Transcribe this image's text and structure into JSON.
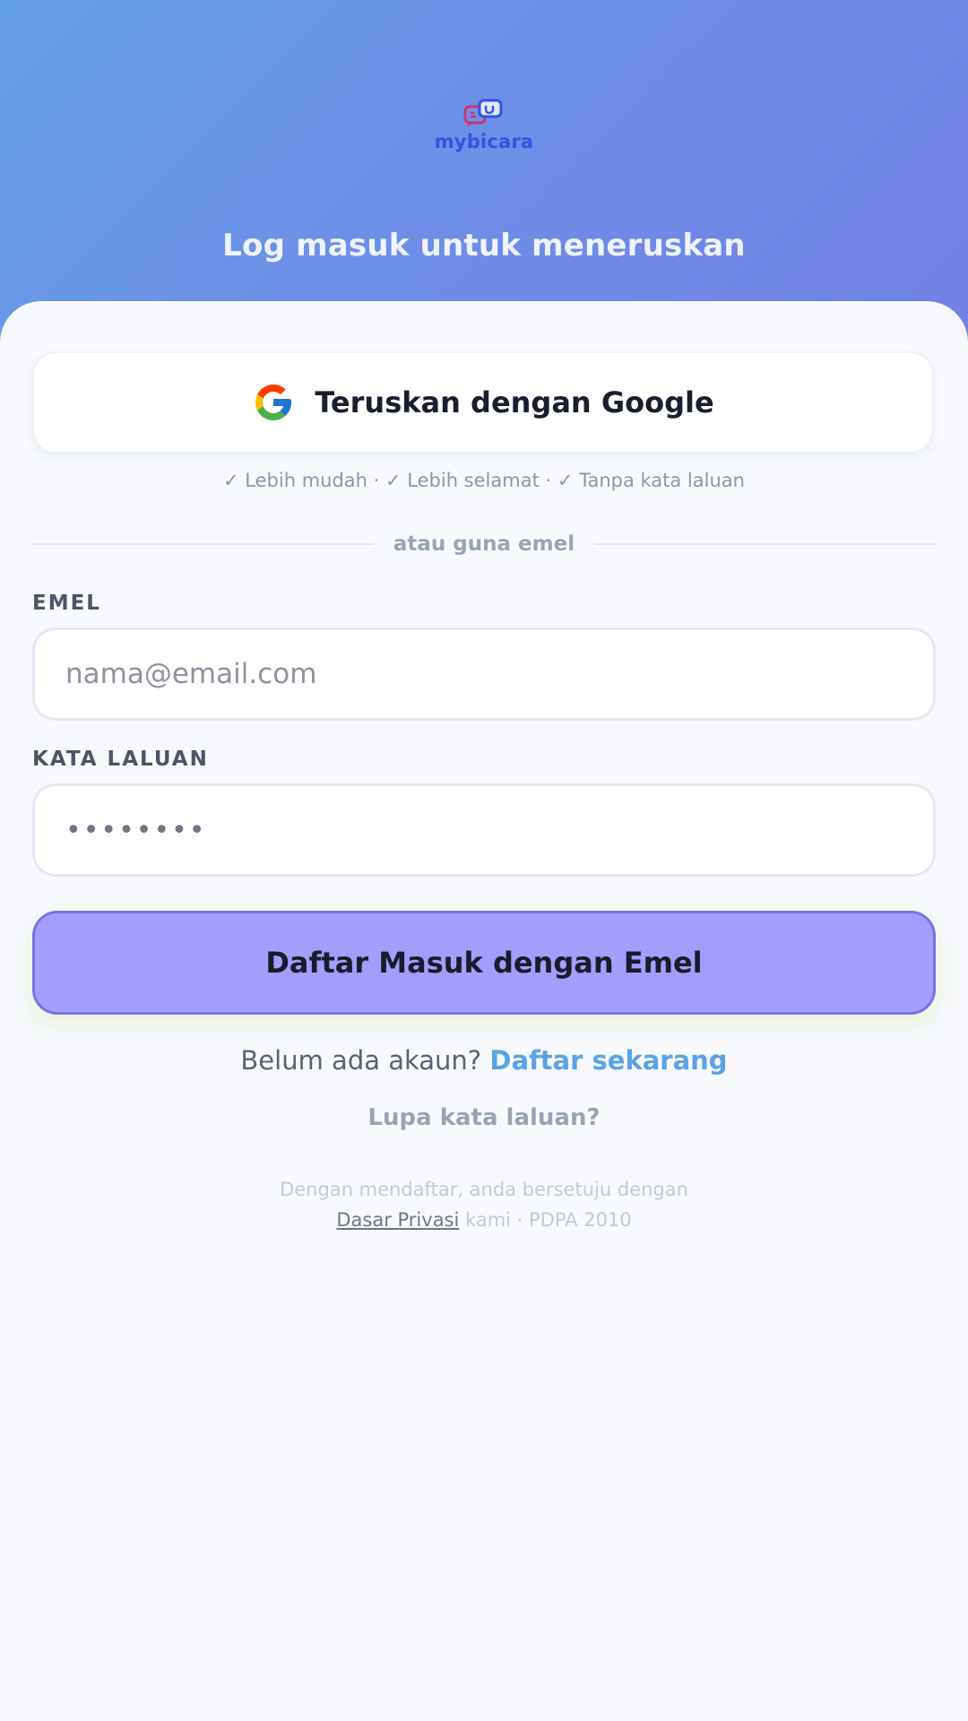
{
  "brand": {
    "name": "mybicara",
    "logo_icon": "chat-bubbles-icon",
    "colors": {
      "hero_gradient_start": "#62a0e6",
      "hero_gradient_end": "#7280e4",
      "primary_button": "#a39dfd",
      "link": "#5aa3e6"
    }
  },
  "header": {
    "title": "Log masuk untuk meneruskan"
  },
  "google": {
    "label": "Teruskan dengan Google",
    "icon": "google-g-icon",
    "perks": "✓ Lebih mudah · ✓ Lebih selamat · ✓ Tanpa kata laluan"
  },
  "divider": {
    "text": "atau guna emel"
  },
  "form": {
    "email_label": "EMEL",
    "email_placeholder": "nama@email.com",
    "email_value": "",
    "password_label": "KATA LALUAN",
    "password_value": "••••••••",
    "submit_label": "Daftar Masuk dengan Emel"
  },
  "footer": {
    "no_account_text": "Belum ada akaun?",
    "signup_link": "Daftar sekarang",
    "forgot_link": "Lupa kata laluan?",
    "legal_line1": "Dengan mendaftar, anda bersetuju dengan",
    "privacy_link": "Dasar Privasi",
    "legal_line2_suffix": "kami · PDPA 2010"
  }
}
